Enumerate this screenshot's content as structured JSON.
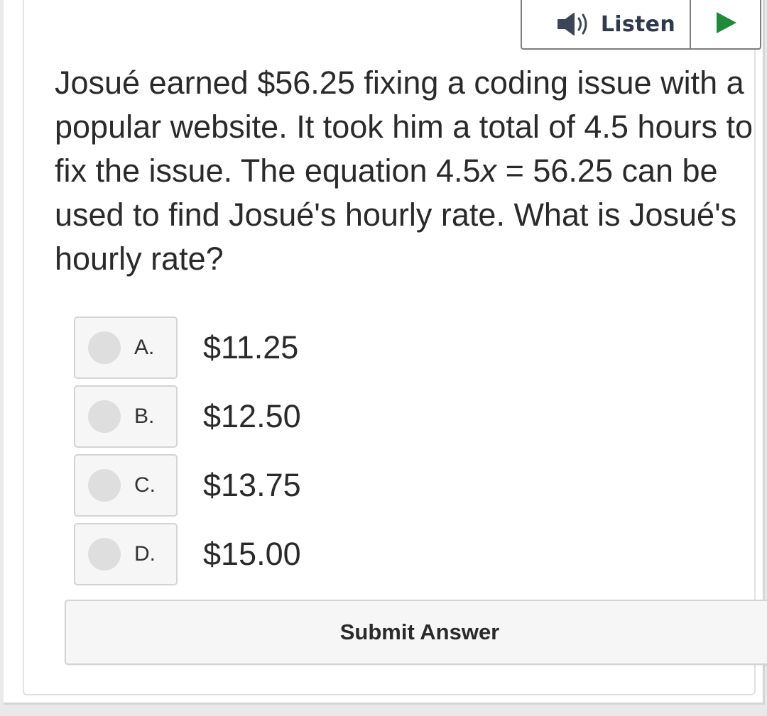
{
  "listen": {
    "label": "Listen",
    "speaker_icon": "speaker-icon",
    "play_icon": "play-icon",
    "play_color": "#1f8a3a"
  },
  "question": {
    "before_variable": "Josué earned $56.25 fixing a coding issue with a popular website. It took him a total of 4.5 hours to fix the issue. The equation 4.5",
    "variable": "x",
    "after_variable": " = 56.25 can be used to find Josué's hourly rate. What is Josué's hourly rate?"
  },
  "choices": [
    {
      "letter": "A.",
      "text": "$11.25"
    },
    {
      "letter": "B.",
      "text": "$12.50"
    },
    {
      "letter": "C.",
      "text": "$13.75"
    },
    {
      "letter": "D.",
      "text": "$15.00"
    }
  ],
  "submit": {
    "label": "Submit Answer"
  }
}
